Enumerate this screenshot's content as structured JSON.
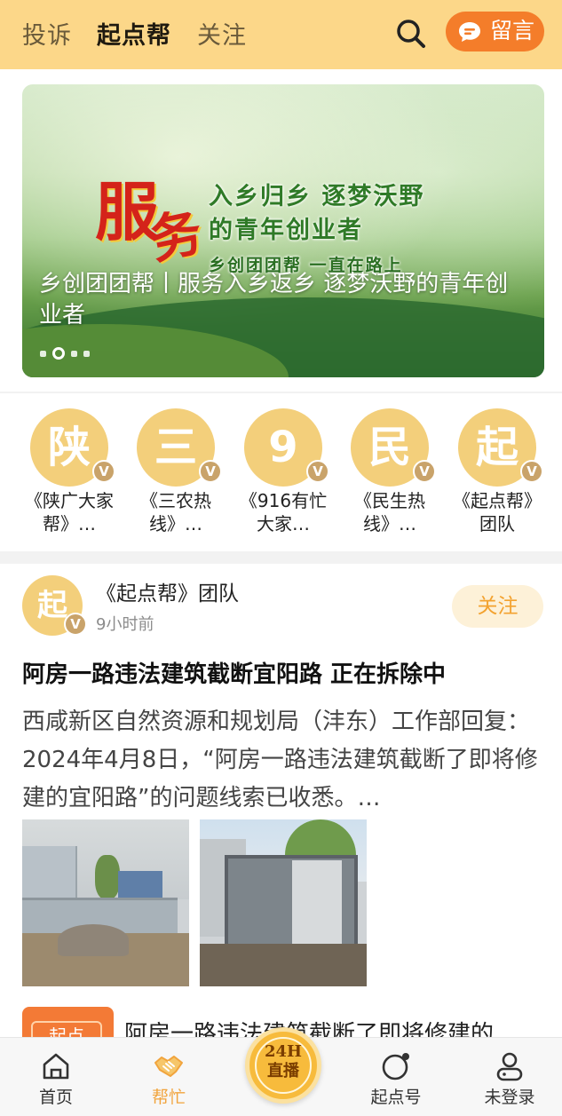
{
  "header": {
    "tabs": [
      {
        "label": "投诉",
        "active": false
      },
      {
        "label": "起点帮",
        "active": true
      },
      {
        "label": "关注",
        "active": false
      }
    ],
    "search_icon": "search-icon",
    "message_button": {
      "label": "留言",
      "icon": "chat-bubble-icon"
    }
  },
  "banner": {
    "title": "乡创团团帮丨服务入乡返乡 逐梦沃野的青年创业者",
    "image_text": {
      "char1": "服",
      "char2": "务",
      "slogan1": "入乡归乡 逐梦沃野",
      "slogan2": "的青年创业者",
      "slogan3": "乡创团团帮 一直在路上"
    },
    "slide_count": 4,
    "active_slide": 2
  },
  "accounts": [
    {
      "avatar": "陕",
      "badge": "V",
      "name": "《陕广大家帮》…"
    },
    {
      "avatar": "三",
      "badge": "V",
      "name": "《三农热线》…"
    },
    {
      "avatar": "9",
      "badge": "V",
      "name": "《916有忙大家…"
    },
    {
      "avatar": "民",
      "badge": "V",
      "name": "《民生热线》…"
    },
    {
      "avatar": "起",
      "badge": "V",
      "name": "《起点帮》团队"
    }
  ],
  "post": {
    "avatar": "起",
    "badge": "V",
    "author": "《起点帮》团队",
    "time": "9小时前",
    "follow_label": "关注",
    "title": "阿房一路违法建筑截断宜阳路 正在拆除中",
    "body": "西咸新区自然资源和规划局（沣东）工作部回复：2024年4月8日，“阿房一路违法建筑截断了即将修建的宜阳路”的问题线索已收悉。…"
  },
  "next_post": {
    "thumb_text": "起点",
    "title": "阿房一路违法建筑截断了即将修建的"
  },
  "bottom_nav": {
    "items": [
      {
        "label": "首页",
        "icon": "home-icon",
        "active": false
      },
      {
        "label": "帮忙",
        "icon": "handshake-icon",
        "active": true
      },
      {
        "label": "起点号",
        "icon": "circle-dot-icon",
        "active": false
      },
      {
        "label": "未登录",
        "icon": "user-icon",
        "active": false
      }
    ],
    "live": {
      "line1": "24H",
      "line2": "直播"
    }
  },
  "colors": {
    "header_bg": "#fcd789",
    "accent_orange": "#f47d2a",
    "gold": "#f3cf7b",
    "active_nav": "#f1a43d"
  }
}
